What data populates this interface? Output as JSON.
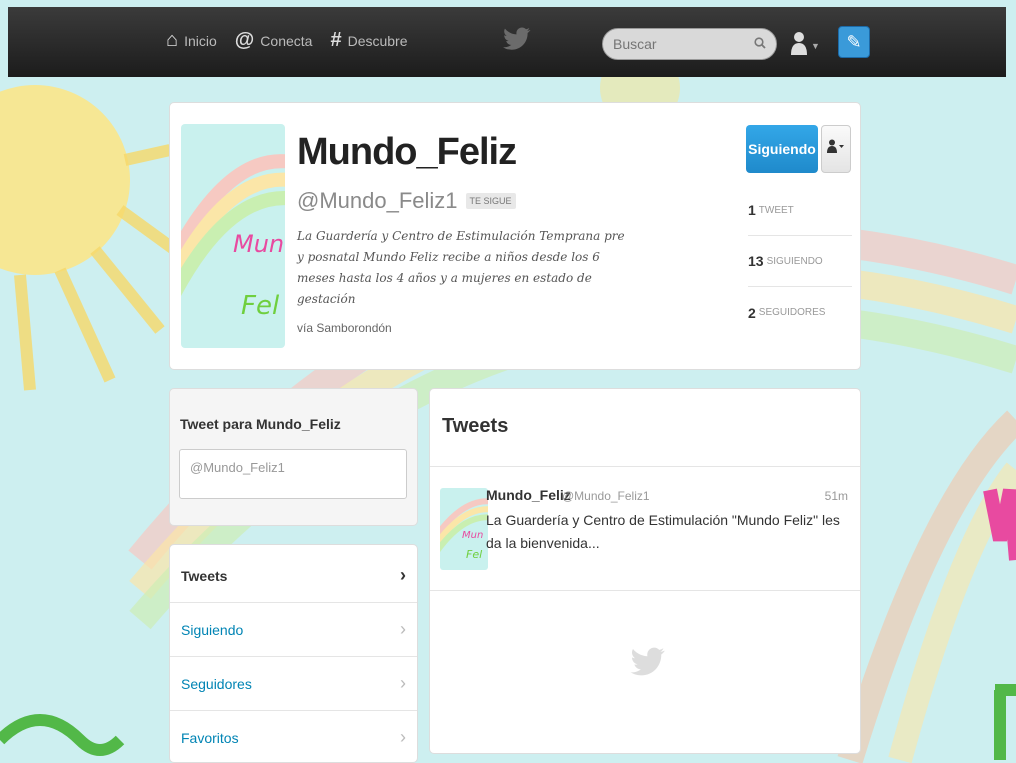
{
  "nav": {
    "items": [
      {
        "icon": "home-icon",
        "glyph": "⌂",
        "label": "Inicio"
      },
      {
        "icon": "at-icon",
        "glyph": "@",
        "label": "Conecta"
      },
      {
        "icon": "hash-icon",
        "glyph": "#",
        "label": "Descubre"
      }
    ],
    "search_placeholder": "Buscar"
  },
  "profile": {
    "name": "Mundo_Feliz",
    "handle": "@Mundo_Feliz1",
    "follows_you": "TE SIGUE",
    "bio": "La Guardería y Centro de Estimulación Temprana pre y posnatal Mundo Feliz recibe a niños desde los 6 meses hasta los 4 años y a mujeres en estado de gestación",
    "location": "vía Samborondón",
    "avatar_text_top": "Mun",
    "avatar_text_bottom": "Fel",
    "following_label": "Siguiendo",
    "stats": [
      {
        "num": "1",
        "label": "TWEET"
      },
      {
        "num": "13",
        "label": "SIGUIENDO"
      },
      {
        "num": "2",
        "label": "SEGUIDORES"
      }
    ]
  },
  "tweetbox": {
    "title": "Tweet para Mundo_Feliz",
    "value": "@Mundo_Feliz1"
  },
  "sidenav": {
    "items": [
      {
        "label": "Tweets",
        "active": true
      },
      {
        "label": "Siguiendo",
        "active": false
      },
      {
        "label": "Seguidores",
        "active": false
      },
      {
        "label": "Favoritos",
        "active": false
      }
    ]
  },
  "stream": {
    "title": "Tweets",
    "tweets": [
      {
        "name": "Mundo_Feliz",
        "handle": "@Mundo_Feliz1",
        "time": "51m",
        "text": "La Guardería y Centro de Estimulación \"Mundo Feliz\" les da la bienvenida..."
      }
    ]
  },
  "colors": {
    "accent": "#2ba0e2",
    "link": "#0084b4",
    "topbar": "#2a2a2a",
    "background": "#cdeff0"
  }
}
